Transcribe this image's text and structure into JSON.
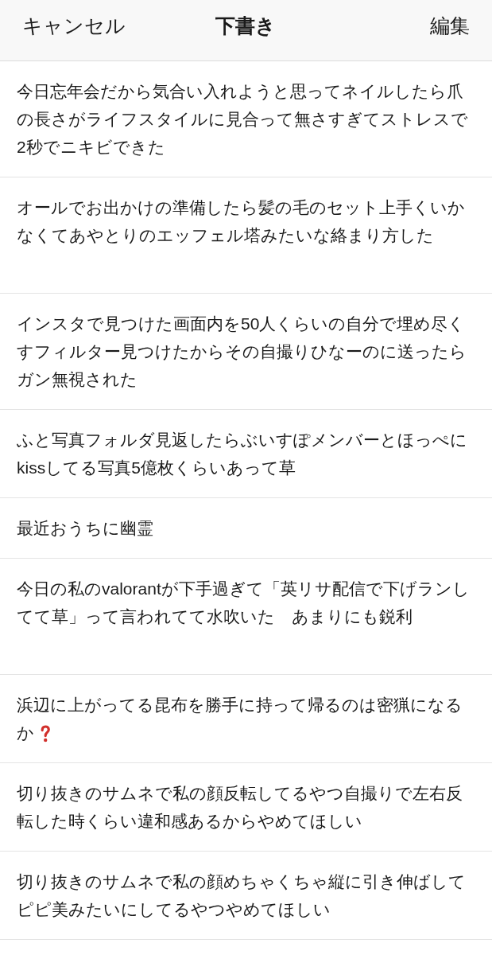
{
  "header": {
    "cancel": "キャンセル",
    "title": "下書き",
    "edit": "編集"
  },
  "drafts": [
    {
      "kind": "plain",
      "text": "今日忘年会だから気合い入れようと思ってネイルしたら爪の長さがライフスタイルに見合って無さすぎてストレスで2秒でニキビできた",
      "trailing_blank_line": false
    },
    {
      "kind": "plain",
      "text": "オールでお出かけの準備したら髪の毛のセット上手くいかなくてあやとりのエッフェル塔みたいな絡まり方した",
      "trailing_blank_line": true
    },
    {
      "kind": "plain",
      "text": "インスタで見つけた画面内を50人くらいの自分で埋め尽くすフィルター見つけたからその自撮りひなーのに送ったらガン無視された",
      "trailing_blank_line": false
    },
    {
      "kind": "plain",
      "text": "ふと写真フォルダ見返したらぶいすぽメンバーとほっぺにkissしてる写真5億枚くらいあって草",
      "trailing_blank_line": false
    },
    {
      "kind": "plain",
      "text": "最近おうちに幽霊",
      "trailing_blank_line": false
    },
    {
      "kind": "plain",
      "text": "今日の私のvalorantが下手過ぎて「英リサ配信で下げランしてて草」って言われてて水吹いた　あまりにも鋭利",
      "trailing_blank_line": true
    },
    {
      "kind": "question",
      "text": "浜辺に上がってる昆布を勝手に持って帰るのは密猟になるか",
      "trailing_blank_line": false
    },
    {
      "kind": "plain",
      "text": "切り抜きのサムネで私の顔反転してるやつ自撮りで左右反転した時くらい違和感あるからやめてほしい",
      "trailing_blank_line": false
    },
    {
      "kind": "plain",
      "text": "切り抜きのサムネで私の顔めちゃくちゃ縦に引き伸ばしてピピ美みたいにしてるやつやめてほしい",
      "trailing_blank_line": false
    }
  ]
}
